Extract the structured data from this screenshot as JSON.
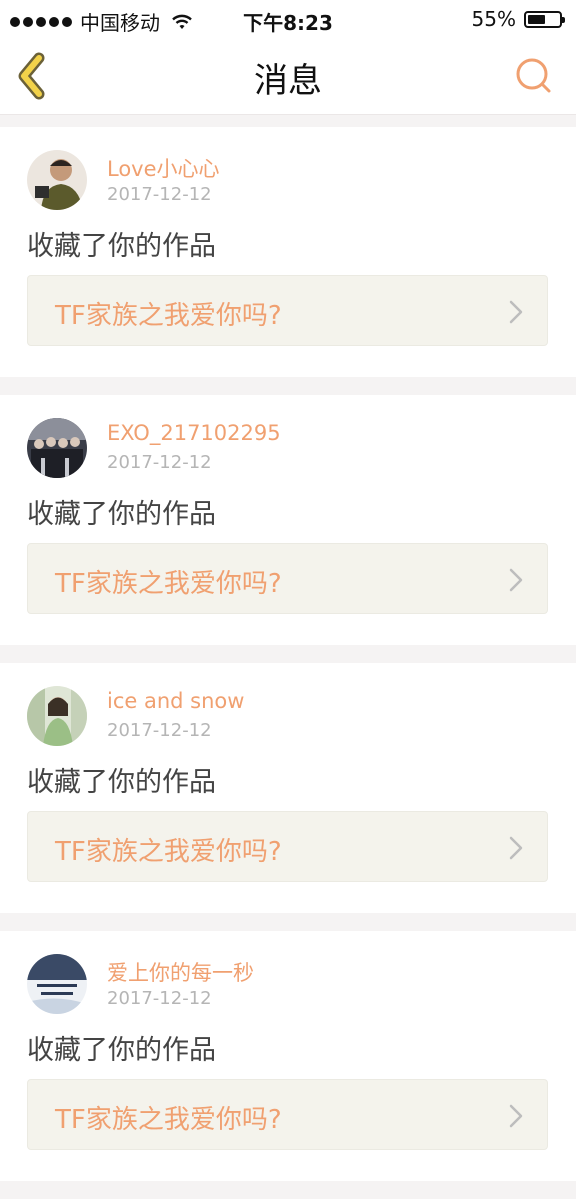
{
  "status_bar": {
    "carrier": "中国移动",
    "time": "下午8:23",
    "battery_text": "55%",
    "battery_level": 0.55
  },
  "header": {
    "title": "消息",
    "back_icon": "chevron-left-icon",
    "search_icon": "search-icon"
  },
  "colors": {
    "accent": "#f0a070",
    "back_icon": "#f2d24a",
    "card_bg": "#f4f3ec",
    "page_bg": "#f5f3f3"
  },
  "messages": [
    {
      "username": "Love小心心",
      "date": "2017-12-12",
      "action": "收藏了你的作品",
      "work_title": "TF家族之我爱你吗?"
    },
    {
      "username": "EXO_217102295",
      "date": "2017-12-12",
      "action": "收藏了你的作品",
      "work_title": "TF家族之我爱你吗?"
    },
    {
      "username": "ice and snow",
      "date": "2017-12-12",
      "action": "收藏了你的作品",
      "work_title": "TF家族之我爱你吗?"
    },
    {
      "username": "爱上你的每一秒",
      "date": "2017-12-12",
      "action": "收藏了你的作品",
      "work_title": "TF家族之我爱你吗?"
    }
  ]
}
